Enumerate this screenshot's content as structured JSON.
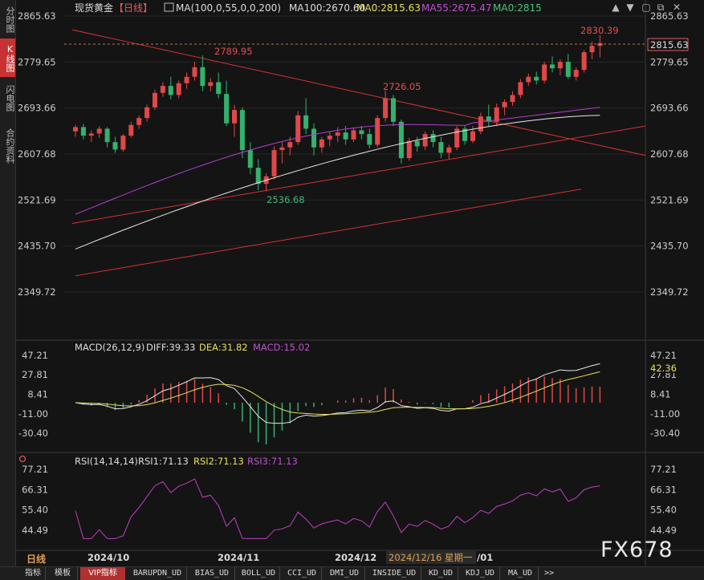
{
  "sidebar": {
    "tabs": [
      {
        "label": "分时图",
        "active": false
      },
      {
        "label": "K线图",
        "active": true
      },
      {
        "label": "闪电图",
        "active": false
      },
      {
        "label": "合约资料",
        "active": false
      }
    ]
  },
  "header": {
    "instrument": "现货黄金",
    "period": "【日线】",
    "ma_group": "MA(100,0,55,0,0,200)",
    "ma100": "MA100:2670.60",
    "ma0a": "MA0:2815.63",
    "ma55": "MA55:2675.47",
    "ma0b": "MA0:2815"
  },
  "toolbar": {
    "icons": [
      "arrow-up-icon",
      "arrow-down-icon",
      "frame-icon",
      "restore-icon",
      "close-icon"
    ]
  },
  "price_axis": {
    "ticks": [
      "2865.63",
      "2779.65",
      "2693.66",
      "2607.68",
      "2521.69",
      "2435.70",
      "2349.72"
    ],
    "current": "2815.63",
    "left_ticks": [
      "2865.63",
      "2779.65",
      "2693.66",
      "2607.68",
      "2521.69",
      "2435.70",
      "2349.72"
    ]
  },
  "annotations": {
    "high_oct": "2789.95",
    "low_nov": "2536.68",
    "high_nov": "2726.05",
    "high_jan": "2830.39"
  },
  "macd": {
    "title": "MACD(26,12,9)",
    "diff": "DIFF:39.33",
    "dea": "DEA:31.82",
    "macd": "MACD:15.02",
    "ticks": [
      "47.21",
      "27.81",
      "8.41",
      "-11.00",
      "-30.40"
    ],
    "current": "42.36"
  },
  "rsi": {
    "title": "RSI(14,14,14)",
    "rsi1": "RSI1:71.13",
    "rsi2": "RSI2:71.13",
    "rsi3": "RSI3:71.13",
    "ticks": [
      "77.21",
      "66.31",
      "55.40",
      "44.49"
    ]
  },
  "time_axis": {
    "period_label": "日线",
    "labels": [
      "2024/10",
      "2024/11",
      "2024/12"
    ],
    "cursor_label": "2024/12/16 星期一",
    "trailing_label": "/01"
  },
  "bottom_tabs": [
    "指标",
    "模板",
    "VIP指标",
    "BARUPDN_UD",
    "BIAS_UD",
    "BOLL_UD",
    "CCI_UD",
    "DMI_UD",
    "INSIDE_UD",
    "KD_UD",
    "KDJ_UD",
    "MA_UD",
    ">>"
  ],
  "watermark": "FX678",
  "colors": {
    "up": "#e04848",
    "down": "#33b26e",
    "ma100": "#e8e8e8",
    "ma55": "#b040d0",
    "trend": "#d83030",
    "dea": "#e6e05a",
    "rsi": "#c040c0"
  },
  "chart_data": {
    "type": "candlestick",
    "instrument": "现货黄金",
    "period": "日线",
    "x_labels": [
      "2024/10",
      "2024/11",
      "2024/12"
    ],
    "price_axis_range": [
      2349.72,
      2865.63
    ],
    "candles": [
      [
        2650,
        2662,
        2640,
        2658
      ],
      [
        2658,
        2664,
        2635,
        2642
      ],
      [
        2642,
        2652,
        2630,
        2646
      ],
      [
        2646,
        2660,
        2638,
        2655
      ],
      [
        2655,
        2658,
        2620,
        2630
      ],
      [
        2630,
        2640,
        2610,
        2616
      ],
      [
        2616,
        2645,
        2612,
        2642
      ],
      [
        2642,
        2668,
        2638,
        2662
      ],
      [
        2662,
        2680,
        2655,
        2675
      ],
      [
        2675,
        2700,
        2668,
        2695
      ],
      [
        2695,
        2728,
        2690,
        2722
      ],
      [
        2722,
        2742,
        2715,
        2735
      ],
      [
        2735,
        2752,
        2710,
        2718
      ],
      [
        2718,
        2745,
        2712,
        2740
      ],
      [
        2740,
        2760,
        2730,
        2752
      ],
      [
        2752,
        2780,
        2745,
        2770
      ],
      [
        2770,
        2792,
        2725,
        2735
      ],
      [
        2735,
        2750,
        2725,
        2742
      ],
      [
        2742,
        2760,
        2712,
        2720
      ],
      [
        2720,
        2745,
        2660,
        2665
      ],
      [
        2665,
        2700,
        2640,
        2690
      ],
      [
        2690,
        2695,
        2600,
        2615
      ],
      [
        2615,
        2630,
        2570,
        2582
      ],
      [
        2582,
        2598,
        2540,
        2552
      ],
      [
        2552,
        2572,
        2538,
        2566
      ],
      [
        2566,
        2622,
        2560,
        2615
      ],
      [
        2615,
        2630,
        2590,
        2620
      ],
      [
        2620,
        2640,
        2605,
        2630
      ],
      [
        2630,
        2688,
        2625,
        2680
      ],
      [
        2680,
        2712,
        2645,
        2655
      ],
      [
        2655,
        2665,
        2605,
        2620
      ],
      [
        2620,
        2640,
        2610,
        2635
      ],
      [
        2635,
        2650,
        2622,
        2642
      ],
      [
        2642,
        2658,
        2630,
        2648
      ],
      [
        2648,
        2660,
        2625,
        2635
      ],
      [
        2635,
        2658,
        2630,
        2652
      ],
      [
        2652,
        2660,
        2635,
        2645
      ],
      [
        2645,
        2655,
        2618,
        2625
      ],
      [
        2625,
        2680,
        2620,
        2675
      ],
      [
        2675,
        2726,
        2668,
        2712
      ],
      [
        2712,
        2718,
        2660,
        2668
      ],
      [
        2668,
        2672,
        2590,
        2600
      ],
      [
        2600,
        2638,
        2595,
        2632
      ],
      [
        2632,
        2640,
        2612,
        2622
      ],
      [
        2622,
        2650,
        2615,
        2645
      ],
      [
        2645,
        2652,
        2620,
        2630
      ],
      [
        2630,
        2640,
        2600,
        2610
      ],
      [
        2610,
        2625,
        2598,
        2620
      ],
      [
        2620,
        2660,
        2615,
        2655
      ],
      [
        2655,
        2660,
        2625,
        2632
      ],
      [
        2632,
        2660,
        2628,
        2650
      ],
      [
        2650,
        2685,
        2645,
        2678
      ],
      [
        2678,
        2700,
        2660,
        2668
      ],
      [
        2668,
        2702,
        2660,
        2695
      ],
      [
        2695,
        2710,
        2680,
        2705
      ],
      [
        2705,
        2725,
        2698,
        2718
      ],
      [
        2718,
        2748,
        2712,
        2742
      ],
      [
        2742,
        2758,
        2735,
        2752
      ],
      [
        2752,
        2762,
        2738,
        2745
      ],
      [
        2745,
        2780,
        2740,
        2775
      ],
      [
        2775,
        2790,
        2760,
        2768
      ],
      [
        2768,
        2785,
        2755,
        2780
      ],
      [
        2780,
        2795,
        2748,
        2752
      ],
      [
        2752,
        2770,
        2745,
        2765
      ],
      [
        2765,
        2802,
        2760,
        2798
      ],
      [
        2798,
        2818,
        2785,
        2810
      ],
      [
        2810,
        2830,
        2788,
        2815
      ]
    ]
  }
}
